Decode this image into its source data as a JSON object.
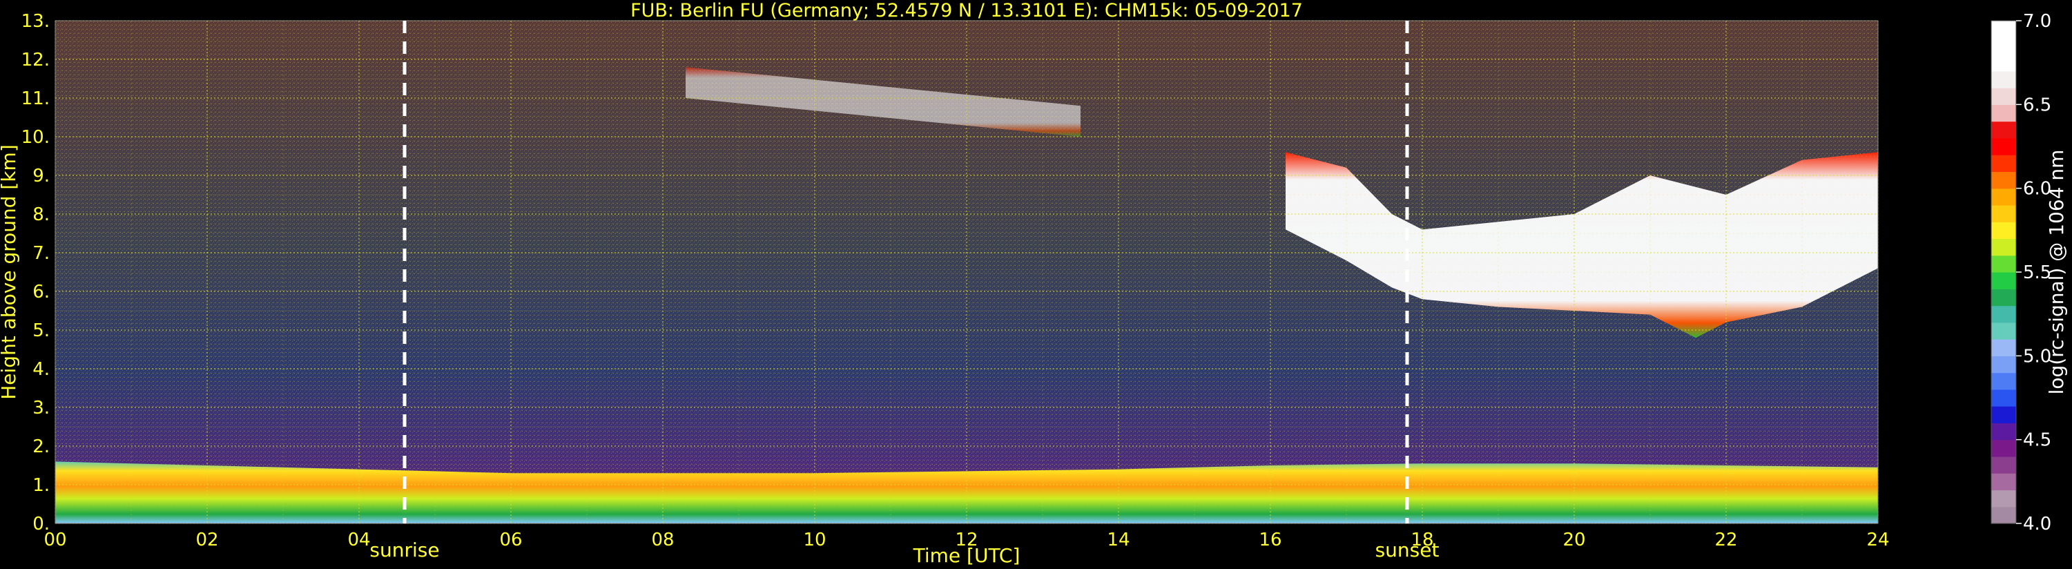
{
  "chart_data": {
    "type": "heatmap",
    "title": "FUB: Berlin FU (Germany; 52.4579 N / 13.3101 E):    CHM15k: 05-09-2017",
    "xlabel": "Time [UTC]",
    "ylabel": "Height above ground [km]",
    "xlim": [
      0,
      24
    ],
    "ylim": [
      0,
      13
    ],
    "x_ticks": [
      "00",
      "02",
      "04",
      "06",
      "08",
      "10",
      "12",
      "14",
      "16",
      "18",
      "20",
      "22",
      "24"
    ],
    "y_ticks": [
      "0.",
      "1.",
      "2.",
      "3.",
      "4.",
      "5.",
      "6.",
      "7.",
      "8.",
      "9.",
      "10.",
      "11.",
      "12.",
      "13."
    ],
    "grid": true,
    "colorbar": {
      "label": "log(rc-signal) @ 1064 nm",
      "range": [
        4.0,
        7.0
      ],
      "ticks": [
        "4.0",
        "4.5",
        "5.0",
        "5.5",
        "6.0",
        "6.5",
        "7.0"
      ]
    },
    "annotations": [
      {
        "text": "sunrise",
        "x": 4.6
      },
      {
        "text": "sunset",
        "x": 17.8
      }
    ],
    "layers": {
      "boundary_layer_top_km": [
        [
          0,
          1.6
        ],
        [
          2,
          1.5
        ],
        [
          4,
          1.4
        ],
        [
          6,
          1.3
        ],
        [
          8,
          1.3
        ],
        [
          10,
          1.3
        ],
        [
          12,
          1.35
        ],
        [
          14,
          1.4
        ],
        [
          16,
          1.5
        ],
        [
          18,
          1.55
        ],
        [
          20,
          1.55
        ],
        [
          22,
          1.5
        ],
        [
          24,
          1.45
        ]
      ],
      "cirrus_cloud": [
        {
          "start": 16.2,
          "end": 24,
          "base_km": [
            [
              16.2,
              7.6
            ],
            [
              17,
              6.8
            ],
            [
              17.6,
              6.1
            ],
            [
              18,
              5.8
            ],
            [
              19,
              5.6
            ],
            [
              20,
              5.5
            ],
            [
              21,
              5.4
            ],
            [
              21.6,
              4.8
            ],
            [
              22,
              5.2
            ],
            [
              23,
              5.6
            ],
            [
              24,
              6.6
            ]
          ],
          "top_km": [
            [
              16.2,
              9.6
            ],
            [
              17,
              9.2
            ],
            [
              17.6,
              8.0
            ],
            [
              18,
              7.6
            ],
            [
              19,
              7.8
            ],
            [
              20,
              8.0
            ],
            [
              21,
              9.0
            ],
            [
              22,
              8.5
            ],
            [
              23,
              9.4
            ],
            [
              24,
              9.6
            ]
          ]
        },
        {
          "start": 8.3,
          "end": 13.5,
          "base_km": [
            [
              8.3,
              11.0
            ],
            [
              13.5,
              10.0
            ]
          ],
          "top_km": [
            [
              8.3,
              11.8
            ],
            [
              13.5,
              10.8
            ]
          ]
        }
      ]
    }
  }
}
